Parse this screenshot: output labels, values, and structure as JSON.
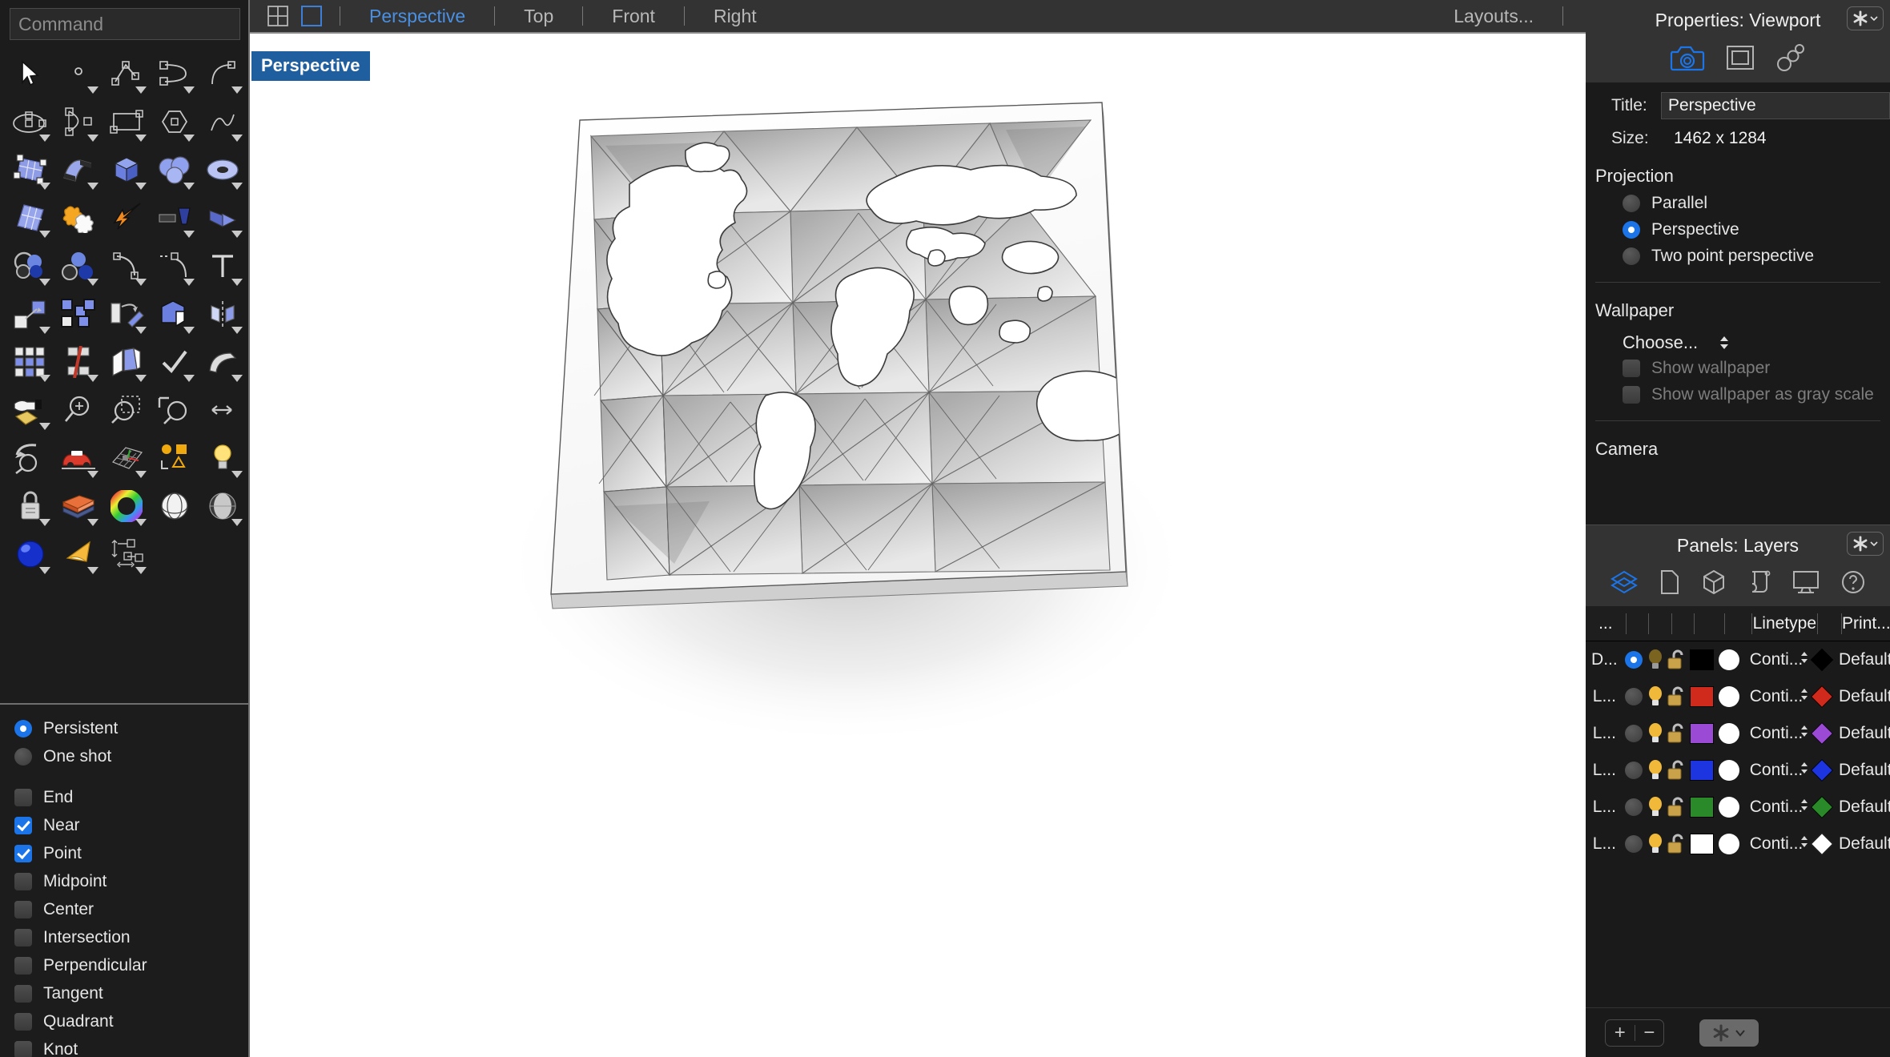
{
  "command": {
    "placeholder": "Command",
    "value": ""
  },
  "menubar": {
    "icons": [
      "four-view-icon",
      "single-view-icon"
    ],
    "items": [
      {
        "label": "Perspective",
        "active": true
      },
      {
        "label": "Top",
        "active": false
      },
      {
        "label": "Front",
        "active": false
      },
      {
        "label": "Right",
        "active": false
      }
    ],
    "layouts_label": "Layouts..."
  },
  "viewport": {
    "label": "Perspective"
  },
  "osnap": {
    "modes": [
      {
        "label": "Persistent",
        "selected": true
      },
      {
        "label": "One shot",
        "selected": false
      }
    ],
    "snaps": [
      {
        "label": "End",
        "checked": false
      },
      {
        "label": "Near",
        "checked": true
      },
      {
        "label": "Point",
        "checked": true
      },
      {
        "label": "Midpoint",
        "checked": false
      },
      {
        "label": "Center",
        "checked": false
      },
      {
        "label": "Intersection",
        "checked": false
      },
      {
        "label": "Perpendicular",
        "checked": false
      },
      {
        "label": "Tangent",
        "checked": false
      },
      {
        "label": "Quadrant",
        "checked": false
      },
      {
        "label": "Knot",
        "checked": false
      }
    ]
  },
  "properties": {
    "title": "Properties: Viewport",
    "tabs": [
      "camera-icon",
      "viewport-frame-icon",
      "chain-links-icon"
    ],
    "active_tab": 0,
    "fields": {
      "title_label": "Title:",
      "title_value": "Perspective",
      "size_label": "Size:",
      "size_value": "1462 x 1284"
    },
    "projection": {
      "heading": "Projection",
      "options": [
        {
          "label": "Parallel",
          "selected": false
        },
        {
          "label": "Perspective",
          "selected": true
        },
        {
          "label": "Two point perspective",
          "selected": false
        }
      ]
    },
    "wallpaper": {
      "heading": "Wallpaper",
      "choose_label": "Choose...",
      "checkboxes": [
        {
          "label": "Show wallpaper",
          "checked": false,
          "disabled": true
        },
        {
          "label": "Show wallpaper as gray scale",
          "checked": false,
          "disabled": true
        }
      ]
    },
    "camera_heading": "Camera"
  },
  "layers": {
    "title": "Panels: Layers",
    "tabs": [
      "layers-icon",
      "page-icon",
      "cube-icon",
      "scroll-icon",
      "display-icon",
      "help-icon"
    ],
    "active_tab": 0,
    "columns": [
      "...",
      "",
      "",
      "",
      "",
      "",
      "Linetype",
      "",
      "Print..."
    ],
    "rows": [
      {
        "name": "D...",
        "current": true,
        "light": "on",
        "lock": "unlocked",
        "color": "#000000",
        "material": "#ffffff",
        "linetype": "Conti...",
        "print_swatch": "#000000",
        "print_width": "Default"
      },
      {
        "name": "L...",
        "current": false,
        "light": "on",
        "lock": "unlocked",
        "color": "#cf2a1b",
        "material": "#ffffff",
        "linetype": "Conti...",
        "print_swatch": "#cf2a1b",
        "print_width": "Default"
      },
      {
        "name": "L...",
        "current": false,
        "light": "on",
        "lock": "unlocked",
        "color": "#9a4ad4",
        "material": "#ffffff",
        "linetype": "Conti...",
        "print_swatch": "#9a4ad4",
        "print_width": "Default"
      },
      {
        "name": "L...",
        "current": false,
        "light": "on",
        "lock": "unlocked",
        "color": "#1c35e0",
        "material": "#ffffff",
        "linetype": "Conti...",
        "print_swatch": "#1c35e0",
        "print_width": "Default"
      },
      {
        "name": "L...",
        "current": false,
        "light": "on",
        "lock": "unlocked",
        "color": "#2a8a2a",
        "material": "#ffffff",
        "linetype": "Conti...",
        "print_swatch": "#2a8a2a",
        "print_width": "Default"
      },
      {
        "name": "L...",
        "current": false,
        "light": "on",
        "lock": "unlocked",
        "color": "#ffffff",
        "material": "#ffffff",
        "linetype": "Conti...",
        "print_swatch": "#ffffff",
        "print_width": "Default"
      }
    ],
    "footer": {
      "add_label": "+",
      "remove_label": "−",
      "gear": "gear-icon"
    }
  },
  "colors": {
    "accent": "#1b75e8",
    "menu_active": "#4a90e2",
    "panel_bg": "#1a1a1a",
    "head_bg": "#333333",
    "viewport_bg": "#ffffff",
    "vp_label_bg": "#1f5fa0"
  }
}
